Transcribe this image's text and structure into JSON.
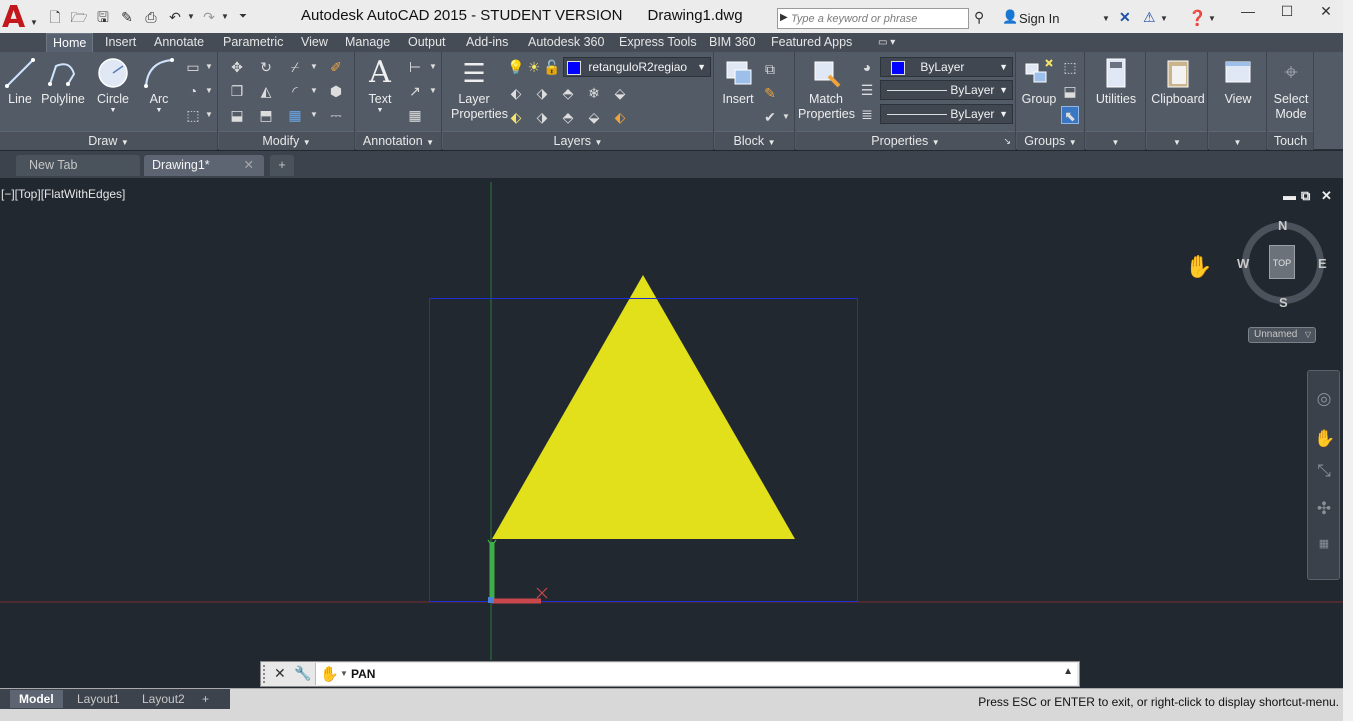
{
  "titlebar": {
    "window_title": "Autodesk AutoCAD 2015 - STUDENT VERSION      Drawing1.dwg",
    "search_placeholder": "Type a keyword or phrase",
    "sign_in": "Sign In"
  },
  "ribbon_tabs": [
    "Home",
    "Insert",
    "Annotate",
    "Parametric",
    "View",
    "Manage",
    "Output",
    "Add-ins",
    "Autodesk 360",
    "Express Tools",
    "BIM 360",
    "Featured Apps"
  ],
  "ribbon": {
    "draw": {
      "label": "Draw",
      "tools": [
        "Line",
        "Polyline",
        "Circle",
        "Arc"
      ]
    },
    "modify": {
      "label": "Modify"
    },
    "annotation": {
      "label": "Annotation",
      "text_tool": "Text"
    },
    "layers": {
      "label": "Layers",
      "layer_properties_l1": "Layer",
      "layer_properties_l2": "Properties",
      "current_layer": "retanguloR2regiao"
    },
    "block": {
      "label": "Block",
      "insert": "Insert"
    },
    "properties": {
      "label": "Properties",
      "match_l1": "Match",
      "match_l2": "Properties",
      "color": "ByLayer",
      "linetype": "ByLayer",
      "lineweight": "ByLayer"
    },
    "groups": {
      "label": "Groups",
      "group": "Group"
    },
    "utilities": "Utilities",
    "clipboard": "Clipboard",
    "view": "View",
    "touch": {
      "label": "Touch",
      "select_mode_l1": "Select",
      "select_mode_l2": "Mode"
    }
  },
  "file_tabs": [
    {
      "label": "New Tab"
    },
    {
      "label": "Drawing1*"
    }
  ],
  "viewport": {
    "label": "[−][Top][FlatWithEdges]",
    "viewcube": {
      "face": "TOP",
      "north": "N",
      "south": "S",
      "east": "E",
      "west": "W"
    },
    "ucs_name": "Unnamed",
    "colors": {
      "triangle_fill": "#e1e01a",
      "rectangle_stroke": "#1e2fd6",
      "x_axis": "#c9474b",
      "y_axis": "#3fae49"
    }
  },
  "command_line": {
    "text": "PAN"
  },
  "layout_tabs": [
    "Model",
    "Layout1",
    "Layout2"
  ],
  "status_message": "Press ESC or ENTER to exit, or right-click to display shortcut-menu."
}
